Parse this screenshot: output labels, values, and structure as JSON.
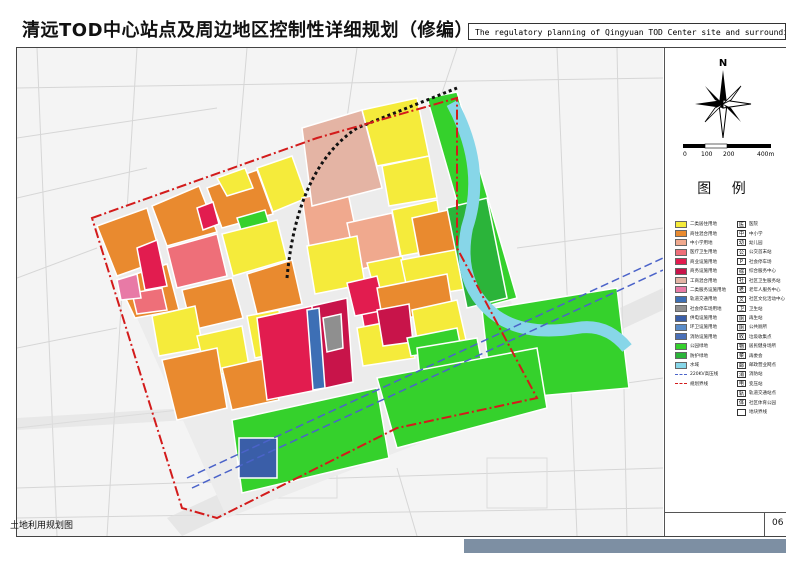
{
  "header": {
    "title_cn": "清远TOD中心站点及周边地区控制性详细规划（修编）",
    "title_en": "The regulatory planning of Qingyuan TOD Center site and surrounding area"
  },
  "compass": {
    "north_label": "N"
  },
  "scale": {
    "ticks": [
      "0",
      "100",
      "200",
      "400m"
    ]
  },
  "legend": {
    "title": "图 例",
    "landuse": [
      {
        "label": "二类居住用地",
        "color": "#f5eb3b"
      },
      {
        "label": "商住混合用地",
        "color": "#e98a2f"
      },
      {
        "label": "中小学用地",
        "color": "#f0a98e"
      },
      {
        "label": "医疗卫生用地",
        "color": "#ee6f79"
      },
      {
        "label": "商业设施用地",
        "color": "#e21c4f"
      },
      {
        "label": "商务设施用地",
        "color": "#c8144a"
      },
      {
        "label": "工商混合用地",
        "color": "#e4b4a4"
      },
      {
        "label": "二类服务设施用地",
        "color": "#e87aa6"
      },
      {
        "label": "轨道交通用地",
        "color": "#3d6fb5"
      },
      {
        "label": "社会停车场用地",
        "color": "#8f8f8f"
      },
      {
        "label": "供电设施用地",
        "color": "#3a5ea8"
      },
      {
        "label": "环卫设施用地",
        "color": "#5a8cc8"
      },
      {
        "label": "消防设施用地",
        "color": "#4a6fb7"
      },
      {
        "label": "公园绿地",
        "color": "#35d12c"
      },
      {
        "label": "防护绿地",
        "color": "#2bb43a"
      },
      {
        "label": "水域",
        "color": "#87d6e8"
      },
      {
        "label": "220KV高压线",
        "color": "#4b63c9"
      },
      {
        "label": "规划界线",
        "color": "#d31b1b"
      }
    ],
    "facilities": [
      {
        "sym": "医",
        "label": "医院"
      },
      {
        "sym": "中",
        "label": "中小学"
      },
      {
        "sym": "幼",
        "label": "幼儿园"
      },
      {
        "sym": "公",
        "label": "公交首末站"
      },
      {
        "sym": "P",
        "label": "社会停车场"
      },
      {
        "sym": "综",
        "label": "综合服务中心"
      },
      {
        "sym": "社",
        "label": "社区卫生服务站"
      },
      {
        "sym": "老",
        "label": "老年人服务中心"
      },
      {
        "sym": "文",
        "label": "社区文化活动中心"
      },
      {
        "sym": "卫",
        "label": "卫生站"
      },
      {
        "sym": "厕",
        "label": "再生站"
      },
      {
        "sym": "厕",
        "label": "公共厕所"
      },
      {
        "sym": "收",
        "label": "垃圾收集点"
      },
      {
        "sym": "物",
        "label": "居民健身场所"
      },
      {
        "sym": "菜",
        "label": "再委会"
      },
      {
        "sym": "邮",
        "label": "邮政营业网点"
      },
      {
        "sym": "消",
        "label": "消防站"
      },
      {
        "sym": "电",
        "label": "变压站"
      },
      {
        "sym": "轨",
        "label": "轨道交通站点"
      },
      {
        "sym": "体",
        "label": "社区体育公园"
      },
      {
        "sym": "",
        "label": "地块界线"
      }
    ]
  },
  "footer": {
    "map_title": "土地利用规划图",
    "page_number": "06"
  }
}
